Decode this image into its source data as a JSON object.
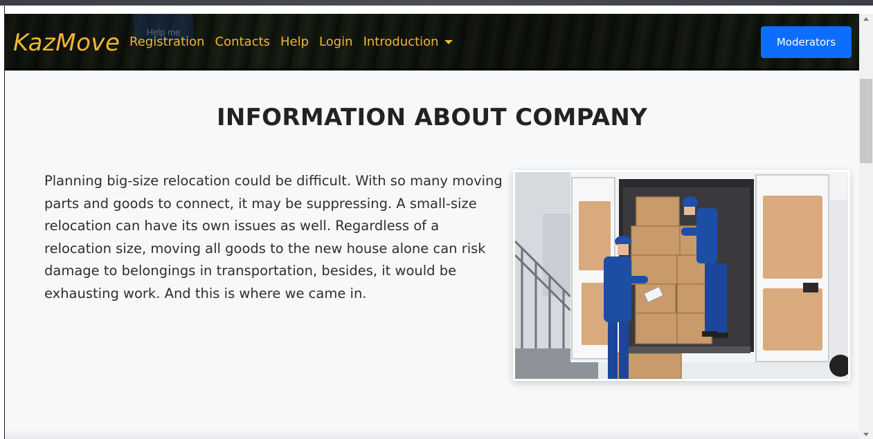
{
  "navbar": {
    "brand": "KazMove",
    "ghost_button_label": "Help me",
    "links": [
      {
        "label": "Registration"
      },
      {
        "label": "Contacts"
      },
      {
        "label": "Help"
      },
      {
        "label": "Login"
      },
      {
        "label": "Introduction"
      }
    ],
    "moderators_label": "Moderators"
  },
  "main": {
    "title": "INFORMATION ABOUT COMPANY",
    "paragraph": "Planning big-size relocation could be difficult. With so many moving parts and goods to connect, it may be suppressing. A small-size relocation can have its own issues as well. Regardless of a relocation size, moving all goods to the new house alone can risk damage to belongings in transportation, besides, it would be exhausting work. And this is where we came in."
  },
  "colors": {
    "brand": "#f2b632",
    "primary_button": "#0d6efd",
    "content_background": "#f7f8fa"
  },
  "icons": {
    "dropdown": "caret-down-icon",
    "scroll_up": "scroll-up-arrow-icon",
    "scroll_down": "scroll-down-arrow-icon"
  }
}
